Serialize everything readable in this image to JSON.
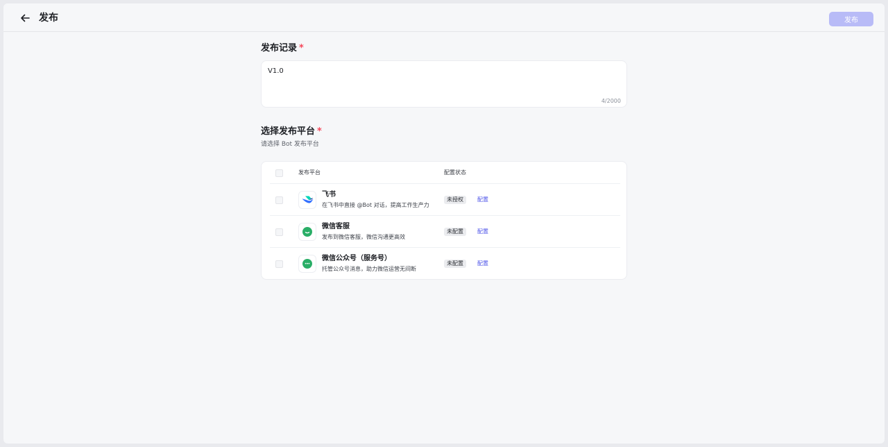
{
  "header": {
    "title": "发布",
    "publish_label": "发布"
  },
  "record": {
    "title": "发布记录",
    "required_mark": "*",
    "value": "V1.0",
    "counter": "4/2000"
  },
  "platforms": {
    "title": "选择发布平台",
    "required_mark": "*",
    "hint": "请选择 Bot 发布平台",
    "columns": [
      "发布平台",
      "配置状态"
    ],
    "rows": [
      {
        "name": "飞书",
        "desc": "在飞书中直接 @Bot 对话，提高工作生产力",
        "status": "未授权",
        "action": "配置",
        "icon": "feishu-logo-icon"
      },
      {
        "name": "微信客服",
        "desc": "发布到微信客服，微信沟通更高效",
        "status": "未配置",
        "action": "配置",
        "icon": "wechat-service-logo-icon"
      },
      {
        "name": "微信公众号（服务号）",
        "desc": "托管公众号消息，助力微信运营无间断",
        "status": "未配置",
        "action": "配置",
        "icon": "wechat-official-logo-icon"
      }
    ]
  },
  "colors": {
    "accent": "#4d53e8",
    "disabled_button": "#b8bbf7",
    "required": "#f5475a",
    "wechat_green": "#2aae67"
  }
}
